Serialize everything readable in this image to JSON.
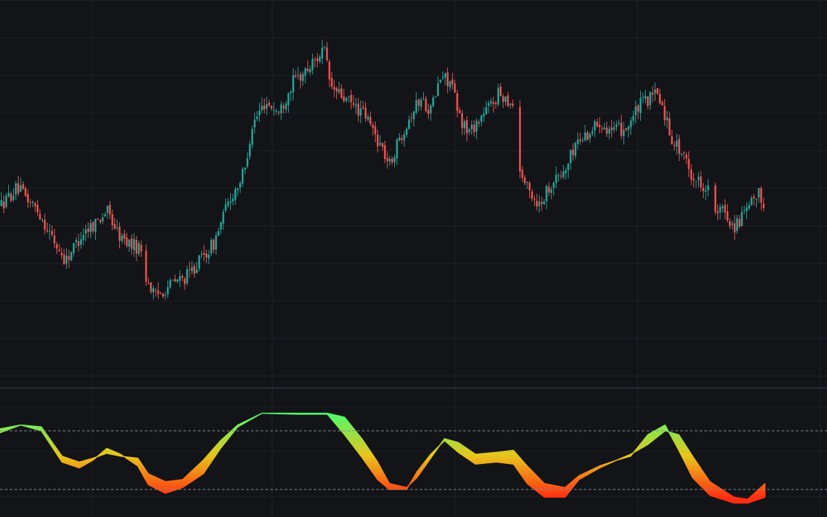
{
  "colors": {
    "background": "#131418",
    "grid": "#1f2026",
    "separator": "#2b2c33",
    "bullish": "#26a69a",
    "bearish": "#ef5350",
    "oscillator_high": "#4cfa6c",
    "oscillator_mid": "#e8c51c",
    "oscillator_low": "#ff2e12",
    "level_lines": "#8a8c93"
  },
  "chart_data": [
    {
      "type": "candlestick",
      "title": "",
      "xlabel": "",
      "ylabel": "",
      "grid": true,
      "ylim": [
        0,
        100
      ],
      "gaps": [
        [
          205,
          212
        ],
        [
          745,
          752
        ],
        [
          1028,
          1035
        ]
      ],
      "anchors": [
        [
          2,
          60
        ],
        [
          25,
          66
        ],
        [
          55,
          58
        ],
        [
          80,
          46
        ],
        [
          95,
          40
        ],
        [
          120,
          50
        ],
        [
          140,
          54
        ],
        [
          155,
          58
        ],
        [
          175,
          48
        ],
        [
          205,
          44
        ],
        [
          212,
          34
        ],
        [
          225,
          27
        ],
        [
          250,
          32
        ],
        [
          270,
          34
        ],
        [
          290,
          40
        ],
        [
          310,
          46
        ],
        [
          330,
          60
        ],
        [
          355,
          72
        ],
        [
          365,
          88
        ],
        [
          385,
          97
        ],
        [
          405,
          93
        ],
        [
          425,
          104
        ],
        [
          445,
          108
        ],
        [
          470,
          116
        ],
        [
          480,
          102
        ],
        [
          500,
          98
        ],
        [
          530,
          92
        ],
        [
          555,
          80
        ],
        [
          565,
          74
        ],
        [
          580,
          84
        ],
        [
          595,
          92
        ],
        [
          610,
          98
        ],
        [
          625,
          94
        ],
        [
          640,
          106
        ],
        [
          655,
          104
        ],
        [
          665,
          92
        ],
        [
          680,
          86
        ],
        [
          700,
          92
        ],
        [
          725,
          100
        ],
        [
          745,
          96
        ],
        [
          752,
          74
        ],
        [
          765,
          66
        ],
        [
          782,
          60
        ],
        [
          800,
          68
        ],
        [
          820,
          72
        ],
        [
          835,
          82
        ],
        [
          855,
          86
        ],
        [
          870,
          90
        ],
        [
          890,
          86
        ],
        [
          910,
          88
        ],
        [
          930,
          96
        ],
        [
          955,
          100
        ],
        [
          975,
          84
        ],
        [
          990,
          78
        ],
        [
          1005,
          70
        ],
        [
          1028,
          66
        ],
        [
          1035,
          56
        ],
        [
          1050,
          58
        ],
        [
          1065,
          52
        ],
        [
          1085,
          58
        ],
        [
          1100,
          64
        ],
        [
          1110,
          60
        ]
      ]
    },
    {
      "type": "area",
      "title": "",
      "ylim": [
        0,
        100
      ],
      "levels": [
        80,
        20
      ],
      "series": [
        {
          "x": [
            0,
            30,
            60,
            90,
            115,
            135,
            155,
            175,
            200,
            215,
            240,
            265,
            295,
            320,
            345,
            380,
            430,
            475,
            500,
            525,
            548,
            565,
            590,
            605,
            625,
            645,
            665,
            690,
            720,
            745,
            765,
            790,
            820,
            840,
            870,
            895,
            915,
            940,
            965,
            985,
            1005,
            1030,
            1065,
            1085,
            1110
          ],
          "y": [
            78,
            86,
            80,
            48,
            42,
            50,
            62,
            56,
            44,
            25,
            16,
            22,
            36,
            62,
            84,
            98,
            97,
            97,
            76,
            53,
            30,
            20,
            20,
            38,
            56,
            70,
            58,
            46,
            48,
            46,
            26,
            12,
            12,
            30,
            42,
            50,
            54,
            76,
            86,
            60,
            32,
            14,
            6,
            6,
            12
          ]
        },
        {
          "x": [
            0,
            30,
            60,
            90,
            115,
            135,
            155,
            175,
            200,
            215,
            240,
            265,
            295,
            320,
            345,
            380,
            430,
            475,
            500,
            525,
            548,
            565,
            590,
            605,
            625,
            645,
            665,
            690,
            720,
            745,
            765,
            790,
            820,
            840,
            870,
            895,
            915,
            940,
            965,
            985,
            1005,
            1030,
            1065,
            1085,
            1110
          ],
          "y": [
            82,
            86,
            84,
            54,
            48,
            52,
            57,
            54,
            52,
            36,
            28,
            30,
            50,
            70,
            86,
            98,
            98,
            98,
            94,
            72,
            48,
            26,
            22,
            32,
            52,
            72,
            68,
            56,
            58,
            60,
            44,
            26,
            22,
            34,
            44,
            50,
            56,
            66,
            80,
            76,
            54,
            28,
            12,
            10,
            26
          ]
        }
      ]
    }
  ]
}
